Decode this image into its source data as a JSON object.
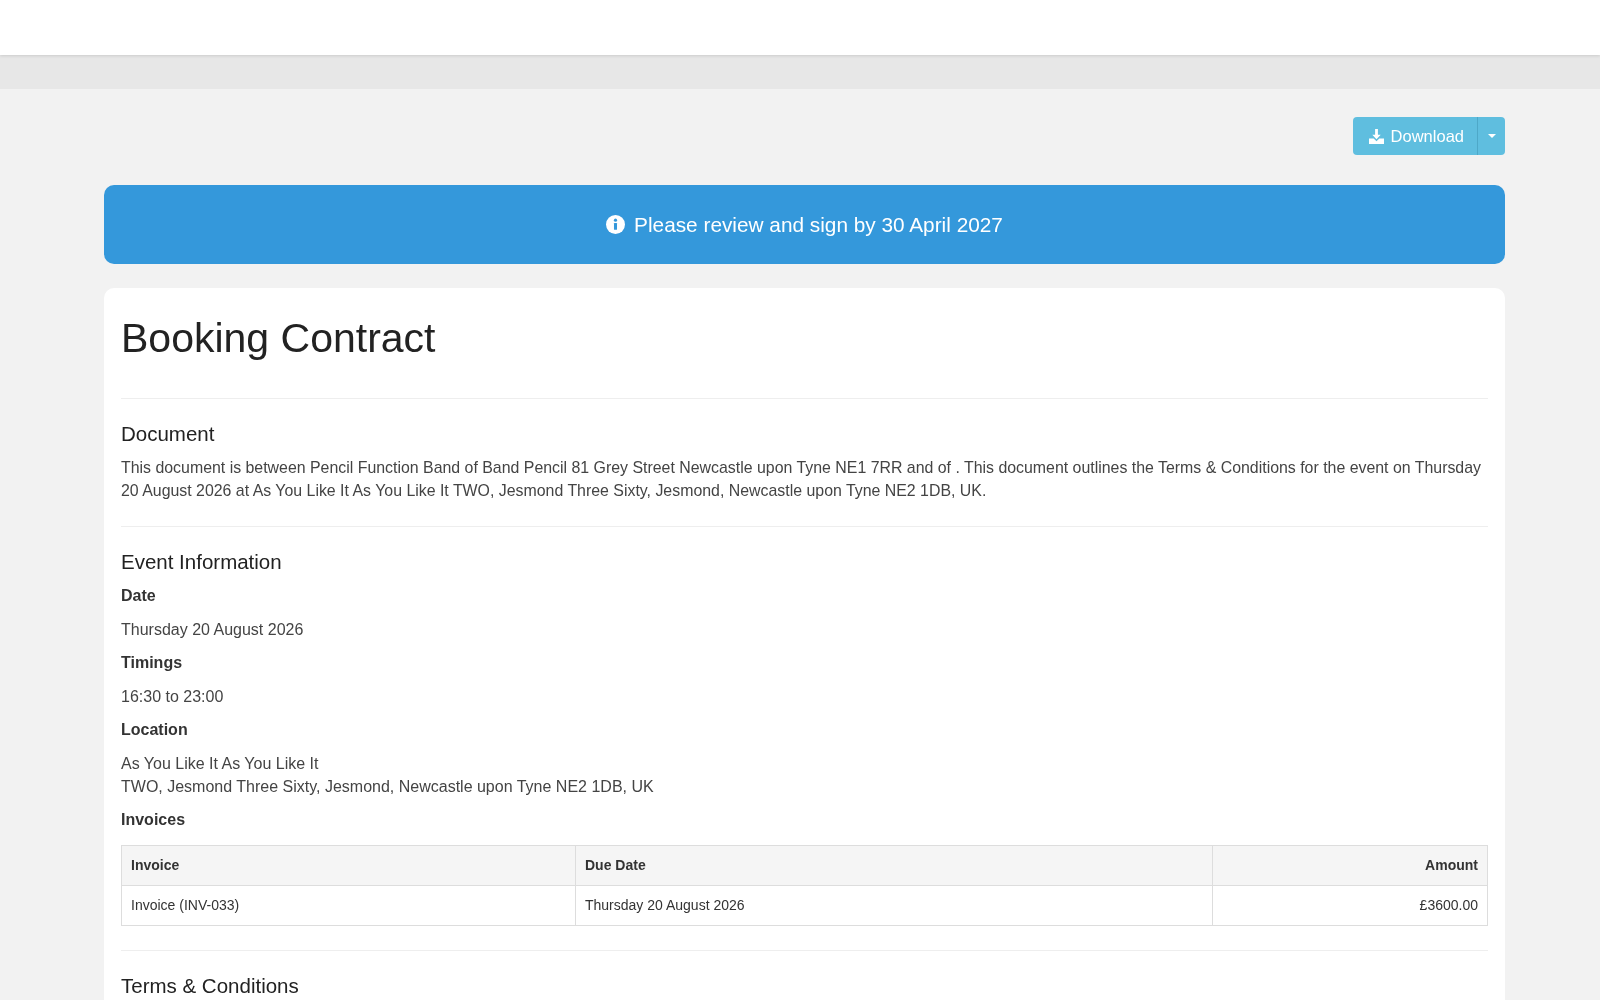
{
  "download_menu": {
    "label": "Download"
  },
  "banner": {
    "text": "Please review and sign by 30 April 2027"
  },
  "contract": {
    "title": "Booking Contract",
    "sections": [
      {
        "kind": "text",
        "heading": "Document",
        "text": "This document is between Pencil Function Band of Band Pencil 81 Grey Street Newcastle upon Tyne NE1 7RR and of . This document outlines the Terms & Conditions for the event on Thursday 20 August 2026 at As You Like It As You Like It TWO, Jesmond Three Sixty, Jesmond, Newcastle upon Tyne NE2 1DB, UK."
      },
      {
        "kind": "fields",
        "heading": "Event Information",
        "fields": [
          {
            "kind": "text",
            "label": "Date",
            "lines": [
              "Thursday 20 August 2026"
            ]
          },
          {
            "kind": "text",
            "label": "Timings",
            "lines": [
              "16:30 to 23:00"
            ]
          },
          {
            "kind": "text",
            "label": "Location",
            "lines": [
              "As You Like It As You Like It",
              "TWO, Jesmond Three Sixty, Jesmond, Newcastle upon Tyne NE2 1DB, UK"
            ]
          },
          {
            "kind": "table",
            "label": "Invoices",
            "columns": [
              "Invoice",
              "Due Date",
              "Amount"
            ],
            "rows": [
              [
                "Invoice (INV-033)",
                "Thursday 20 August 2026",
                "£3600.00"
              ]
            ]
          }
        ]
      },
      {
        "kind": "text",
        "heading": "Terms & Conditions"
      }
    ]
  }
}
